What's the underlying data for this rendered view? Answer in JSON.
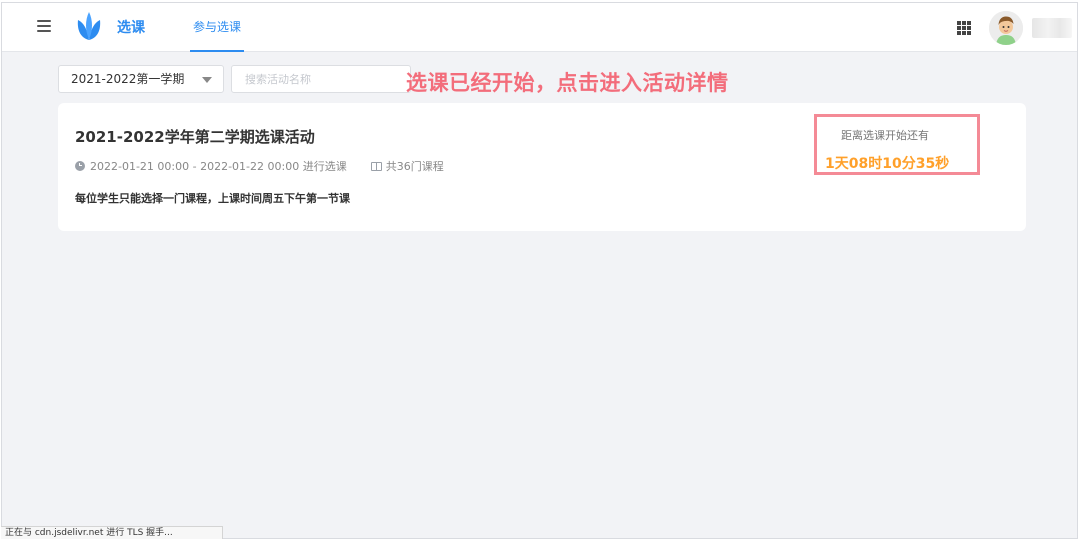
{
  "header": {
    "app_title": "选课",
    "nav_tab": "参与选课",
    "icons": [
      "menu-icon",
      "logo-icon",
      "apps-grid-icon",
      "avatar"
    ]
  },
  "filters": {
    "term_select_value": "2021-2022第一学期",
    "search_placeholder": "搜索活动名称",
    "search_value": ""
  },
  "annotation": "选课已经开始，点击进入活动详情",
  "activity": {
    "title": "2021-2022学年第二学期选课活动",
    "time_range": "2022-01-21 00:00 - 2022-01-22 00:00 进行选课",
    "course_count": "共36门课程",
    "description": "每位学生只能选择一门课程，上课时间周五下午第一节课",
    "countdown_label": "距离选课开始还有",
    "countdown_value": "1天08时10分35秒"
  },
  "status_bar": "正在与 cdn.jsdelivr.net 进行 TLS 握手...",
  "colors": {
    "primary": "#2d8cf0",
    "annotation": "#f36d7b",
    "countdown": "#ffa02a",
    "highlight_border": "#f48a96"
  }
}
